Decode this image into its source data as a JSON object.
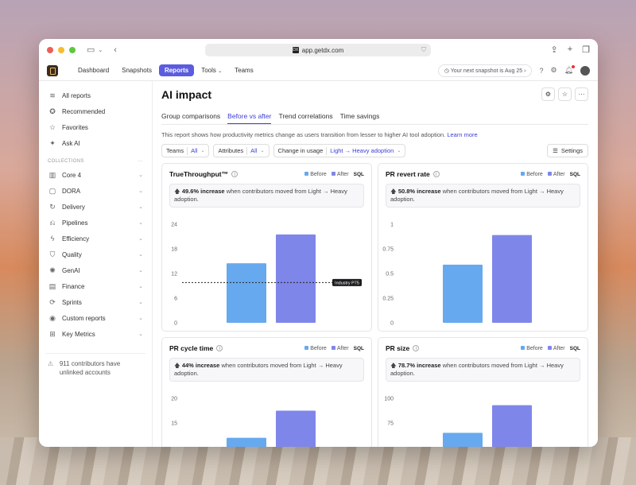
{
  "browser": {
    "url": "app.getdx.com",
    "favicon_text": "DX"
  },
  "nav": {
    "items": [
      "Dashboard",
      "Snapshots",
      "Reports",
      "Tools",
      "Teams"
    ],
    "active": "Reports",
    "snapshot_pill": "Your next snapshot is Aug 25"
  },
  "sidebar": {
    "top_items": [
      {
        "label": "All reports",
        "icon": "layers-icon"
      },
      {
        "label": "Recommended",
        "icon": "star-badge-icon"
      },
      {
        "label": "Favorites",
        "icon": "star-icon"
      },
      {
        "label": "Ask AI",
        "icon": "sparkle-icon"
      }
    ],
    "section_label": "COLLECTIONS",
    "section_more": "···",
    "collections": [
      {
        "label": "Core 4",
        "icon": "chart-icon"
      },
      {
        "label": "DORA",
        "icon": "box-icon"
      },
      {
        "label": "Delivery",
        "icon": "refresh-icon"
      },
      {
        "label": "Pipelines",
        "icon": "pipeline-icon"
      },
      {
        "label": "Efficiency",
        "icon": "bolt-icon"
      },
      {
        "label": "Quality",
        "icon": "shield-icon"
      },
      {
        "label": "GenAI",
        "icon": "brain-icon"
      },
      {
        "label": "Finance",
        "icon": "folder-icon"
      },
      {
        "label": "Sprints",
        "icon": "sprint-icon"
      },
      {
        "label": "Custom reports",
        "icon": "user-icon"
      },
      {
        "label": "Key Metrics",
        "icon": "grid-icon"
      }
    ],
    "note": "911 contributors have unlinked accounts"
  },
  "main": {
    "title": "AI impact",
    "tabs": [
      "Group comparisons",
      "Before vs after",
      "Trend correlations",
      "Time savings"
    ],
    "active_tab": "Before vs after",
    "description": "This report shows how productivity metrics change as users transition from lesser to higher AI tool adoption.",
    "learn_more": "Learn more",
    "filters": {
      "teams_label": "Teams",
      "teams_value": "All",
      "attributes_label": "Attributes",
      "attributes_value": "All",
      "usage_label": "Change in usage",
      "usage_value": "Light → Heavy adoption"
    },
    "settings_label": "Settings"
  },
  "legend": {
    "before": "Before",
    "after": "After",
    "sql": "SQL"
  },
  "colors": {
    "before": "#67a9ee",
    "after": "#7f86ea",
    "accent": "#5b5ce0"
  },
  "cards": [
    {
      "title": "TrueThroughput™",
      "pct": "49.6% increase",
      "rest": "when contributors moved from Light → Heavy adoption."
    },
    {
      "title": "PR revert rate",
      "pct": "50.8% increase",
      "rest": "when contributors moved from Light → Heavy adoption."
    },
    {
      "title": "PR cycle time",
      "pct": "44% increase",
      "rest": "when contributors moved from Light → Heavy adoption."
    },
    {
      "title": "PR size",
      "pct": "78.7% increase",
      "rest": "when contributors moved from Light → Heavy adoption."
    }
  ],
  "chart_data": [
    {
      "type": "bar",
      "title": "TrueThroughput™",
      "categories": [
        "Before",
        "After"
      ],
      "values": [
        14.5,
        21.5
      ],
      "ylim": [
        0,
        24
      ],
      "yticks": [
        0,
        6,
        12,
        18,
        24
      ],
      "reference_line": {
        "label": "Industry P75",
        "value": 9.8
      }
    },
    {
      "type": "bar",
      "title": "PR revert rate",
      "categories": [
        "Before",
        "After"
      ],
      "values": [
        0.59,
        0.89
      ],
      "ylim": [
        0,
        1
      ],
      "yticks": [
        0,
        0.25,
        0.5,
        0.75,
        1
      ]
    },
    {
      "type": "bar",
      "title": "PR cycle time",
      "categories": [
        "Before",
        "After"
      ],
      "values": [
        12,
        17.5
      ],
      "ylim": [
        0,
        20
      ],
      "yticks": [
        15,
        20
      ]
    },
    {
      "type": "bar",
      "title": "PR size",
      "categories": [
        "Before",
        "After"
      ],
      "values": [
        65,
        93
      ],
      "ylim": [
        0,
        100
      ],
      "yticks": [
        75,
        100
      ]
    }
  ]
}
